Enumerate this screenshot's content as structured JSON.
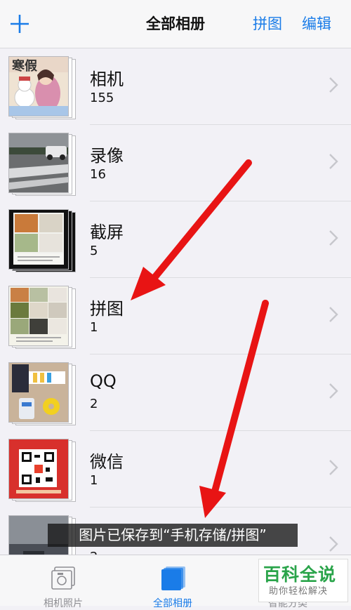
{
  "navbar": {
    "title": "全部相册",
    "collage_label": "拼图",
    "edit_label": "编辑"
  },
  "albums": [
    {
      "name": "相机",
      "count": "155",
      "thumb_text": "寒假"
    },
    {
      "name": "录像",
      "count": "16"
    },
    {
      "name": "截屏",
      "count": "5"
    },
    {
      "name": "拼图",
      "count": "1"
    },
    {
      "name": "QQ",
      "count": "2"
    },
    {
      "name": "微信",
      "count": "1"
    },
    {
      "name": "",
      "count": "2"
    }
  ],
  "caption": "图片已保存到“手机存储/拼图”",
  "tabbar": {
    "tabs": [
      {
        "label": "相机照片",
        "active": false
      },
      {
        "label": "全部相册",
        "active": true
      },
      {
        "label": "智能分类",
        "active": false
      }
    ]
  },
  "watermark": {
    "main": "百科全说",
    "sub": "助你轻松解决"
  },
  "colors": {
    "accent": "#1a7ce8",
    "arrow": "#e81414",
    "background": "#f2f1f6"
  }
}
